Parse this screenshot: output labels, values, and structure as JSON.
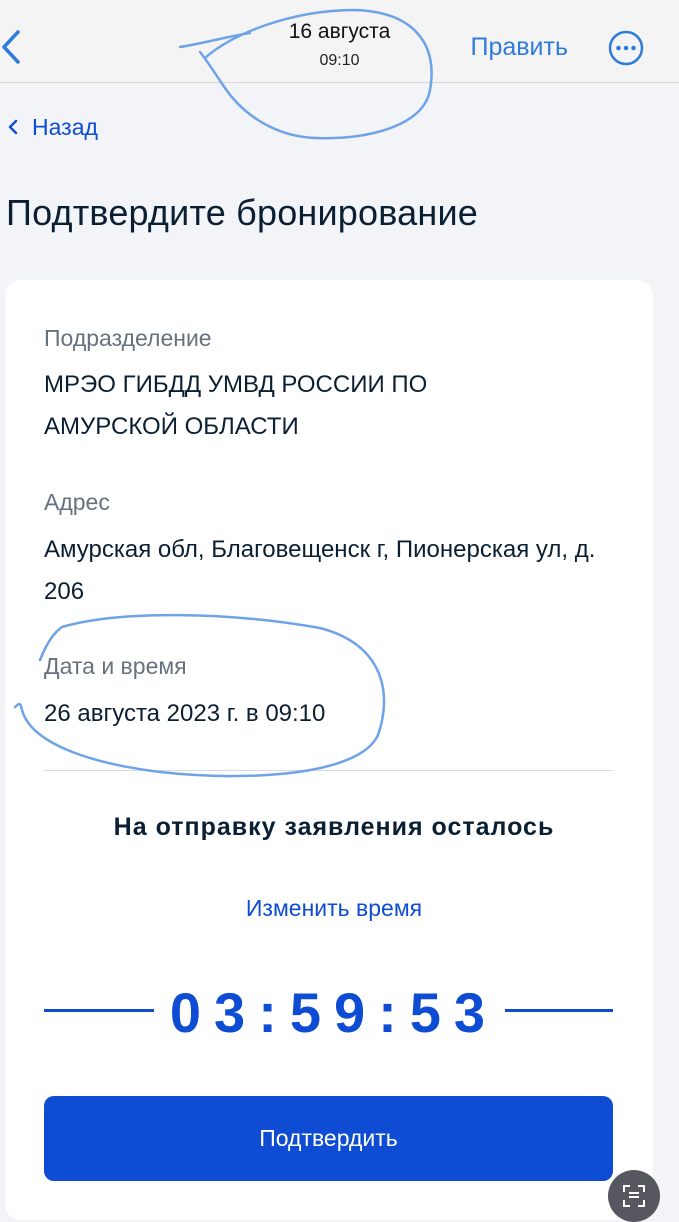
{
  "topbar": {
    "date": "16 августа",
    "time": "09:10",
    "edit_label": "Править",
    "back_icon": "chevron-left-icon",
    "more_icon": "more-circle-icon"
  },
  "nav": {
    "back_label": "Назад"
  },
  "page_title": "Подтвердите бронирование",
  "booking": {
    "division_label": "Подразделение",
    "division_value": "МРЭО ГИБДД УМВД РОССИИ ПО АМУРСКОЙ ОБЛАСТИ",
    "address_label": "Адрес",
    "address_value": "Амурская обл, Благовещенск г, Пионерская ул, д. 206",
    "datetime_label": "Дата и время",
    "datetime_value": "26 августа 2023 г. в 09:10"
  },
  "countdown": {
    "caption": "На отправку заявления осталось",
    "change_time_label": "Изменить время",
    "timer": "03:59:53"
  },
  "confirm_label": "Подтвердить",
  "colors": {
    "accent": "#0d4cd3",
    "ios_link": "#2f7bdc",
    "annotation": "#6fa3e8"
  }
}
